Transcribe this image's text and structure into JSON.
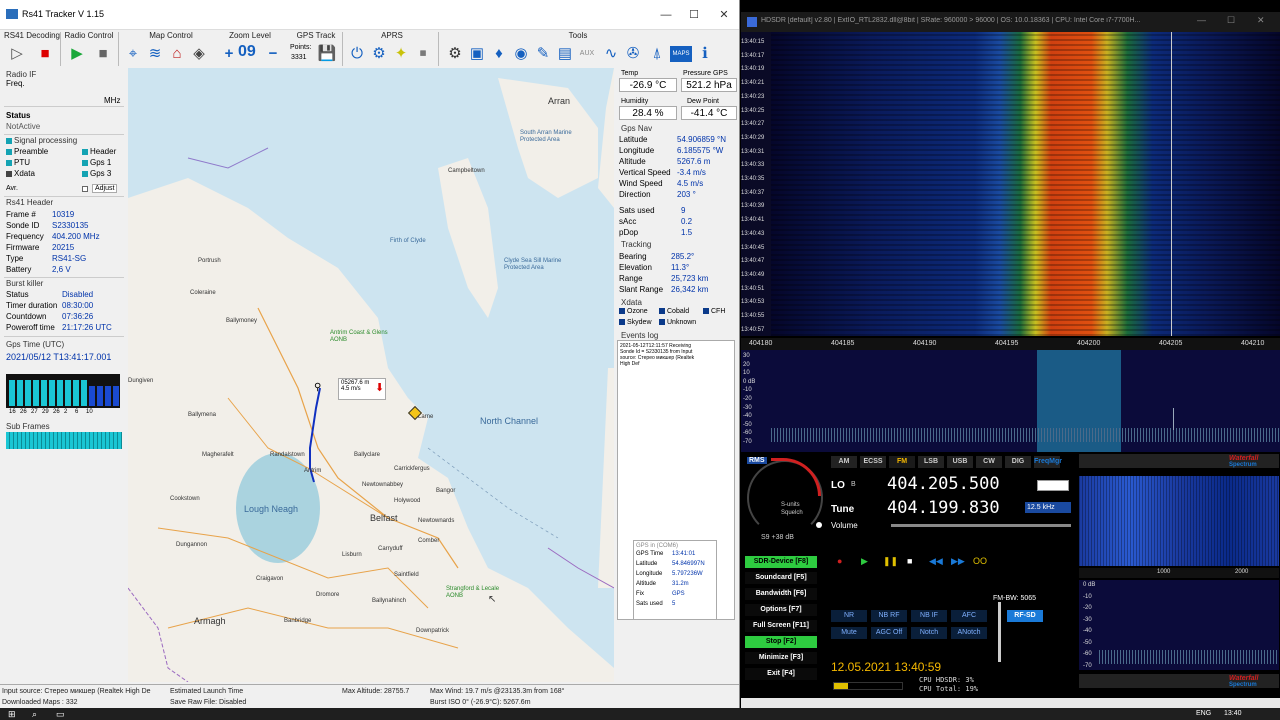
{
  "rs41": {
    "title": "Rs41 Tracker V 1.15",
    "menu": {
      "rs41_decoding": "RS41 Decoding",
      "radio_control": "Radio Control",
      "map_control": "Map Control",
      "zoom_level": "Zoom Level",
      "gps_track": "GPS Track",
      "aprs": "APRS",
      "tools": "Tools"
    },
    "zoom_value": "09",
    "points_label": "Points:",
    "points_value": "3331",
    "radio_if": {
      "label": "Radio IF",
      "freq_label": "Freq.",
      "unit": "MHz"
    },
    "status": {
      "label": "Status",
      "value": "NotActive"
    },
    "signal_processing": {
      "label": "Signal processing",
      "preamble": "Preamble",
      "header": "Header",
      "ptu": "PTU",
      "gps1": "Gps 1",
      "xdata": "Xdata",
      "gps3": "Gps 3",
      "avr": "Avr.",
      "adjust": "Adjust"
    },
    "rs41_header": {
      "label": "Rs41 Header",
      "rows": [
        {
          "k": "Frame #",
          "v": "10319"
        },
        {
          "k": "Sonde ID",
          "v": "S2330135"
        },
        {
          "k": "Frequency",
          "v": "404.200 MHz"
        },
        {
          "k": "Firmware",
          "v": "20215"
        },
        {
          "k": "Type",
          "v": "RS41-SG"
        },
        {
          "k": "Battery",
          "v": "2,6 V"
        }
      ]
    },
    "burst_killer": {
      "label": "Burst killer",
      "rows": [
        {
          "k": "Status",
          "v": "Disabled"
        },
        {
          "k": "Timer duration",
          "v": "08:30:00"
        },
        {
          "k": "Countdown",
          "v": "07:36:26"
        },
        {
          "k": "Poweroff time",
          "v": "21:17:26 UTC"
        }
      ]
    },
    "gps_time": {
      "label": "Gps Time (UTC)",
      "value": "2021/05/12 T13:41:17.001"
    },
    "sat_labels": [
      "16",
      "26",
      "27",
      "29",
      "26",
      "2",
      "6",
      "10"
    ],
    "sub_frames": "Sub Frames",
    "ptu": {
      "temp_label": "Temp",
      "temp_value": "-26.9 °C",
      "pressure_label": "Pressure GPS",
      "pressure_value": "521.2 hPa",
      "humidity_label": "Humidity",
      "humidity_value": "28.4 %",
      "dew_label": "Dew Point",
      "dew_value": "-41.4 °C"
    },
    "gps_nav": {
      "label": "Gps Nav",
      "rows": [
        {
          "k": "Latitude",
          "v": "54.906859 °N"
        },
        {
          "k": "Longitude",
          "v": "6.185575 °W"
        },
        {
          "k": "Altitude",
          "v": "5267.6 m"
        },
        {
          "k": "Vertical Speed",
          "v": "-3.4 m/s"
        },
        {
          "k": "Wind Speed",
          "v": "4.5 m/s"
        },
        {
          "k": "Direction",
          "v": "203 °"
        }
      ],
      "rows2": [
        {
          "k": "Sats used",
          "v": "9"
        },
        {
          "k": "sAcc",
          "v": "0.2"
        },
        {
          "k": "pDop",
          "v": "1.5"
        }
      ]
    },
    "tracking": {
      "label": "Tracking",
      "rows": [
        {
          "k": "Bearing",
          "v": "285.2°"
        },
        {
          "k": "Elevation",
          "v": "11.3°"
        },
        {
          "k": "Range",
          "v": "25,723 km"
        },
        {
          "k": "Slant Range",
          "v": "26,342 km"
        }
      ]
    },
    "xdata": {
      "label": "Xdata",
      "ozone": "Ozone",
      "cobald": "Cobald",
      "cfh": "CFH",
      "skydew": "Skydew",
      "unknown": "Unknown"
    },
    "events": {
      "label": "Events log",
      "line1": "2021-05-12T12:11:57 Receiving",
      "line2": "Sonde Id = S2330135 from Input",
      "line3": "source: Стерео микшер (Realtek",
      "line4": "High Def"
    },
    "gps_com": {
      "label": "GPS in (COM6)",
      "rows": [
        {
          "k": "GPS Time",
          "v": "13:41:01"
        },
        {
          "k": "Latitude",
          "v": "54.846997N"
        },
        {
          "k": "Longitude",
          "v": "5.797236W"
        },
        {
          "k": "Altitude",
          "v": "31.2m"
        },
        {
          "k": "Fix",
          "v": "GPS"
        },
        {
          "k": "Sats used",
          "v": "5"
        }
      ]
    },
    "map": {
      "balloon_alt": "05267.6 m",
      "balloon_speed": "4.5 m/s",
      "places": [
        "Arran",
        "South Arran Marine Protected Area",
        "Campbeltown",
        "Firth of Clyde",
        "Clyde Sea Sill Marine Protected Area",
        "Portrush",
        "Coleraine",
        "Ballymoney",
        "Antrim Coast & Glens AONB",
        "Dungiven",
        "Ballymena",
        "Magherafelt",
        "Randalstown",
        "Antrim",
        "Ballyclare",
        "Carrickfergus",
        "Newtownabbey",
        "Larne",
        "Holywood",
        "Bangor",
        "North Channel",
        "Cookstown",
        "Lough Neagh",
        "Belfast",
        "Newtownards",
        "Dungannon",
        "Lisburn",
        "Comber",
        "Craigavon",
        "Carryduff",
        "Saintfield",
        "Dromore",
        "Ballynahinch",
        "Strangford & Lecale AONB",
        "Armagh",
        "Banbridge",
        "Downpatrick"
      ]
    },
    "status_bar": {
      "input": "Input source: Стерео микшер (Realtek High De",
      "launch": "Estimated Launch Time",
      "max_alt": "Max Altitude: 28755.7",
      "max_wind": "Max Wind: 19.7 m/s @23135.3m from 168°",
      "downloaded": "Downloaded Maps : 332",
      "save_raw": "Save Raw File: Disabled",
      "burst": "Burst ISO 0° (-26.9°C): 5267.6m"
    }
  },
  "hdsdr": {
    "title": "HDSDR  [default]  v2.80  |  ExtIO_RTL2832.dll@8bit  |  SRate: 960000 > 96000  |  OS: 10.0.18363  |  CPU: Intel Core i7-7700H...",
    "time_labels": [
      "13:40:15",
      "13:40:17",
      "13:40:19",
      "13:40:21",
      "13:40:23",
      "13:40:25",
      "13:40:27",
      "13:40:29",
      "13:40:31",
      "13:40:33",
      "13:40:35",
      "13:40:37",
      "13:40:39",
      "13:40:41",
      "13:40:43",
      "13:40:45",
      "13:40:47",
      "13:40:49",
      "13:40:51",
      "13:40:53",
      "13:40:55",
      "13:40:57"
    ],
    "freq_ticks": [
      "404180",
      "404185",
      "404190",
      "404195",
      "404200",
      "404205",
      "404210"
    ],
    "db_ticks": [
      "30",
      "20",
      "10",
      "0 dB",
      "-10",
      "-20",
      "-30",
      "-40",
      "-50",
      "-60",
      "-70"
    ],
    "modes": [
      "AM",
      "ECSS",
      "FM",
      "LSB",
      "USB",
      "CW",
      "DIG",
      "FreqMgr"
    ],
    "lo_label": "LO",
    "lo_value": "404.205.500",
    "tune_label": "Tune",
    "tune_value": "404.199.830",
    "bw_select": "12.5 kHz",
    "volume_label": "Volume",
    "rms_label": "RMS",
    "smeter_scale": "S-units",
    "squelch": "Squelch",
    "smeter_reading": "S9 +38 dB",
    "left_buttons": [
      {
        "label": "SDR-Device",
        "key": "[F8]"
      },
      {
        "label": "Soundcard",
        "key": "[F5]"
      },
      {
        "label": "Bandwidth",
        "key": "[F6]"
      },
      {
        "label": "Options",
        "key": "[F7]"
      },
      {
        "label": "Full Screen",
        "key": "[F11]"
      },
      {
        "label": "Stop",
        "key": "[F2]"
      },
      {
        "label": "Minimize",
        "key": "[F3]"
      },
      {
        "label": "Exit",
        "key": "[F4]"
      }
    ],
    "dsp_row1": [
      "NR",
      "NB RF",
      "NB IF",
      "AFC"
    ],
    "dsp_row2": [
      "Mute",
      "AGC Off",
      "Notch",
      "ANotch"
    ],
    "fm_bw": "FM-BW: 5065",
    "rf_sd": "RF-SD",
    "datetime": "12.05.2021 13:40:59",
    "cpu_hdsdr": "CPU HDSDR:  3%",
    "cpu_total": "CPU Total:  19%",
    "waterfall_label": "Waterfall",
    "spectrum_label": "Spectrum",
    "af_ticks": [
      "1000",
      "2000"
    ],
    "af_db": [
      "0 dB",
      "-10",
      "-20",
      "-30",
      "-40",
      "-50",
      "-60",
      "-70"
    ]
  },
  "taskbar": {
    "lang": "ENG",
    "time": "13:40"
  }
}
